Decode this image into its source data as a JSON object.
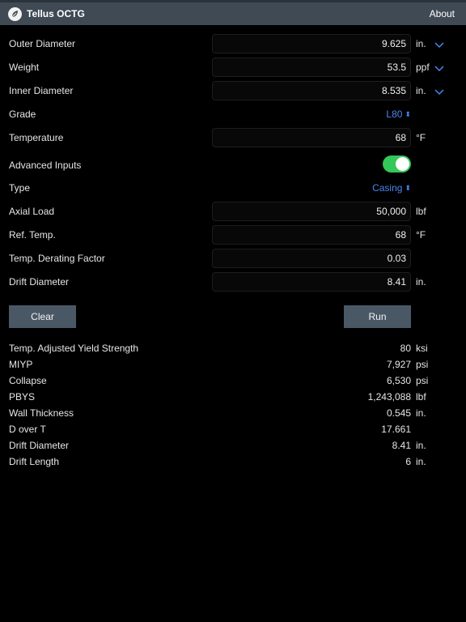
{
  "header": {
    "title": "Tellus OCTG",
    "about": "About"
  },
  "inputs": {
    "outer_diameter": {
      "label": "Outer Diameter",
      "value": "9.625",
      "unit": "in."
    },
    "weight": {
      "label": "Weight",
      "value": "53.5",
      "unit": "ppf"
    },
    "inner_diameter": {
      "label": "Inner Diameter",
      "value": "8.535",
      "unit": "in."
    },
    "grade": {
      "label": "Grade",
      "value": "L80"
    },
    "temperature": {
      "label": "Temperature",
      "value": "68",
      "unit": "°F"
    },
    "advanced": {
      "label": "Advanced Inputs",
      "on": true
    },
    "type": {
      "label": "Type",
      "value": "Casing"
    },
    "axial_load": {
      "label": "Axial Load",
      "value": "50,000",
      "unit": "lbf"
    },
    "ref_temp": {
      "label": "Ref. Temp.",
      "value": "68",
      "unit": "°F"
    },
    "derating": {
      "label": "Temp. Derating Factor",
      "value": "0.03"
    },
    "drift_diameter": {
      "label": "Drift Diameter",
      "value": "8.41",
      "unit": "in."
    }
  },
  "buttons": {
    "clear": "Clear",
    "run": "Run"
  },
  "results": [
    {
      "label": "Temp. Adjusted Yield Strength",
      "value": "80",
      "unit": "ksi"
    },
    {
      "label": "MIYP",
      "value": "7,927",
      "unit": "psi"
    },
    {
      "label": "Collapse",
      "value": "6,530",
      "unit": "psi"
    },
    {
      "label": "PBYS",
      "value": "1,243,088",
      "unit": "lbf"
    },
    {
      "label": "Wall Thickness",
      "value": "0.545",
      "unit": "in."
    },
    {
      "label": "D over T",
      "value": "17.661",
      "unit": ""
    },
    {
      "label": "Drift Diameter",
      "value": "8.41",
      "unit": "in."
    },
    {
      "label": "Drift Length",
      "value": "6",
      "unit": "in."
    }
  ],
  "colors": {
    "accent": "#4b86f0",
    "toggle_on": "#34c759",
    "button_bg": "#4a5866",
    "header_bg": "#3f4a55"
  },
  "icons": {
    "logo": "leaf-icon",
    "dropdown": "chevron-down-icon",
    "stepper": "up-down-chevron-icon"
  }
}
